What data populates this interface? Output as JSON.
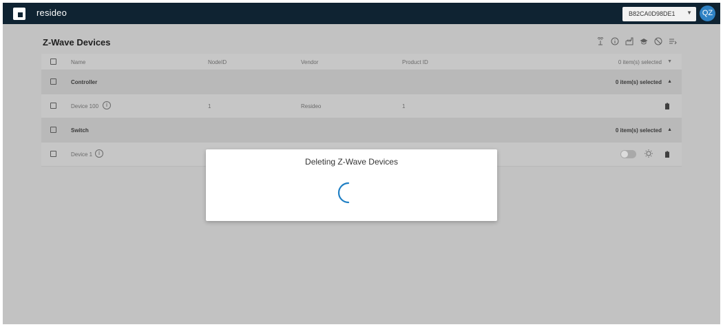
{
  "app": {
    "brand": "resideo",
    "device_id": "B82CA0D98DE1",
    "user_initials": "QZ"
  },
  "page": {
    "title": "Z-Wave Devices"
  },
  "toolbar": {
    "icons": [
      "antenna-icon",
      "info-icon",
      "factory-icon",
      "graduation-cap-icon",
      "block-icon",
      "filter-list-icon"
    ]
  },
  "table": {
    "columns": [
      "Name",
      "NodeID",
      "Vendor",
      "Product ID"
    ],
    "header_selected": "0 item(s) selected",
    "groups": [
      {
        "name": "Controller",
        "selected": "0 item(s) selected",
        "devices": [
          {
            "name": "Device 100",
            "node_id": "1",
            "vendor": "Resideo",
            "product_id": "1"
          }
        ]
      },
      {
        "name": "Switch",
        "selected": "0 item(s) selected",
        "devices": [
          {
            "name": "Device 1",
            "node_id": "",
            "vendor": "",
            "product_id": ""
          }
        ]
      }
    ]
  },
  "modal": {
    "title": "Deleting Z-Wave Devices"
  },
  "colors": {
    "topbar": "#0f2332",
    "accent": "#2f82c4",
    "spinner": "#1f7fc4"
  }
}
